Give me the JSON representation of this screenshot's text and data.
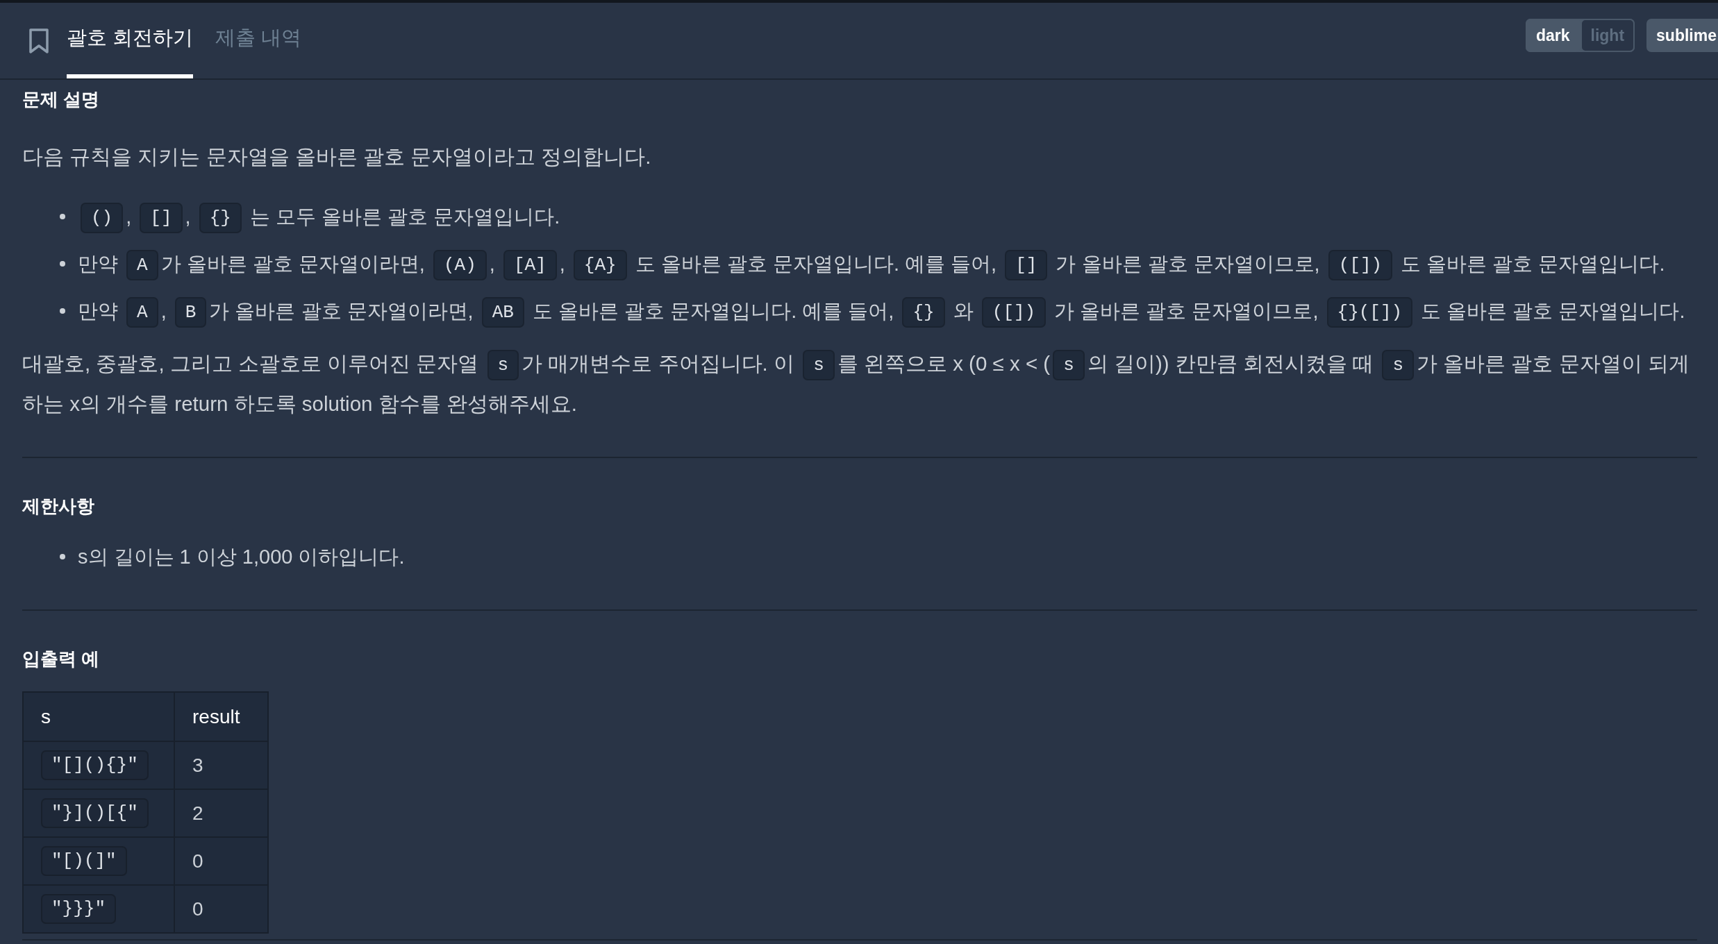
{
  "header": {
    "tabs": [
      {
        "label": "괄호 회전하기",
        "selected": true
      },
      {
        "label": "제출 내역",
        "selected": false
      }
    ],
    "theme_toggle": [
      {
        "label": "dark",
        "selected": true
      },
      {
        "label": "light",
        "selected": false
      }
    ],
    "editor_theme_button": {
      "label": "sublime"
    }
  },
  "sections": [
    {
      "heading": "문제 설명",
      "blocks": [
        {
          "kind": "paragraph",
          "segments": [
            {
              "kind": "text",
              "text": "다음 규칙을 지키는 문자열을 올바른 괄호 문자열이라고 정의합니다."
            }
          ]
        },
        {
          "kind": "list",
          "items": [
            [
              {
                "kind": "code",
                "text": "()"
              },
              {
                "kind": "text",
                "text": ", "
              },
              {
                "kind": "code",
                "text": "[]"
              },
              {
                "kind": "text",
                "text": ", "
              },
              {
                "kind": "code",
                "text": "{}"
              },
              {
                "kind": "text",
                "text": " 는 모두 올바른 괄호 문자열입니다."
              }
            ],
            [
              {
                "kind": "text",
                "text": "만약 "
              },
              {
                "kind": "code",
                "text": "A"
              },
              {
                "kind": "text",
                "text": "가 올바른 괄호 문자열이라면, "
              },
              {
                "kind": "code",
                "text": "(A)"
              },
              {
                "kind": "text",
                "text": ", "
              },
              {
                "kind": "code",
                "text": "[A]"
              },
              {
                "kind": "text",
                "text": ", "
              },
              {
                "kind": "code",
                "text": "{A}"
              },
              {
                "kind": "text",
                "text": " 도 올바른 괄호 문자열입니다. 예를 들어, "
              },
              {
                "kind": "code",
                "text": "[]"
              },
              {
                "kind": "text",
                "text": " 가 올바른 괄호 문자열이므로, "
              },
              {
                "kind": "code",
                "text": "([])"
              },
              {
                "kind": "text",
                "text": " 도 올바른 괄호 문자열입니다."
              }
            ],
            [
              {
                "kind": "text",
                "text": "만약 "
              },
              {
                "kind": "code",
                "text": "A"
              },
              {
                "kind": "text",
                "text": ", "
              },
              {
                "kind": "code",
                "text": "B"
              },
              {
                "kind": "text",
                "text": "가 올바른 괄호 문자열이라면, "
              },
              {
                "kind": "code",
                "text": "AB"
              },
              {
                "kind": "text",
                "text": " 도 올바른 괄호 문자열입니다. 예를 들어, "
              },
              {
                "kind": "code",
                "text": "{}"
              },
              {
                "kind": "text",
                "text": " 와 "
              },
              {
                "kind": "code",
                "text": "([])"
              },
              {
                "kind": "text",
                "text": " 가 올바른 괄호 문자열이므로, "
              },
              {
                "kind": "code",
                "text": "{}([])"
              },
              {
                "kind": "text",
                "text": " 도 올바른 괄호 문자열입니다."
              }
            ]
          ]
        },
        {
          "kind": "paragraph",
          "segments": [
            {
              "kind": "text",
              "text": "대괄호, 중괄호, 그리고 소괄호로 이루어진 문자열 "
            },
            {
              "kind": "code",
              "text": "s"
            },
            {
              "kind": "text",
              "text": "가 매개변수로 주어집니다. 이 "
            },
            {
              "kind": "code",
              "text": "s"
            },
            {
              "kind": "text",
              "text": "를 왼쪽으로 x (0 ≤ x < ("
            },
            {
              "kind": "code",
              "text": "s"
            },
            {
              "kind": "text",
              "text": "의 길이)) 칸만큼 회전시켰을 때 "
            },
            {
              "kind": "code",
              "text": "s"
            },
            {
              "kind": "text",
              "text": "가 올바른 괄호 문자열이 되게 하는 x의 개수를 return 하도록 solution 함수를 완성해주세요."
            }
          ]
        }
      ]
    },
    {
      "heading": "제한사항",
      "blocks": [
        {
          "kind": "list",
          "items": [
            [
              {
                "kind": "text",
                "text": "s의 길이는 1 이상 1,000 이하입니다."
              }
            ]
          ]
        }
      ]
    },
    {
      "heading": "입출력 예",
      "blocks": [
        {
          "kind": "table",
          "columns": [
            "s",
            "result"
          ],
          "rows": [
            [
              {
                "kind": "code",
                "text": "\"[](){}\""
              },
              {
                "kind": "text",
                "text": "3"
              }
            ],
            [
              {
                "kind": "code",
                "text": "\"}]()[{\""
              },
              {
                "kind": "text",
                "text": "2"
              }
            ],
            [
              {
                "kind": "code",
                "text": "\"[)(]\""
              },
              {
                "kind": "text",
                "text": "0"
              }
            ],
            [
              {
                "kind": "code",
                "text": "\"}}}\""
              },
              {
                "kind": "text",
                "text": "0"
              }
            ]
          ]
        }
      ]
    }
  ]
}
